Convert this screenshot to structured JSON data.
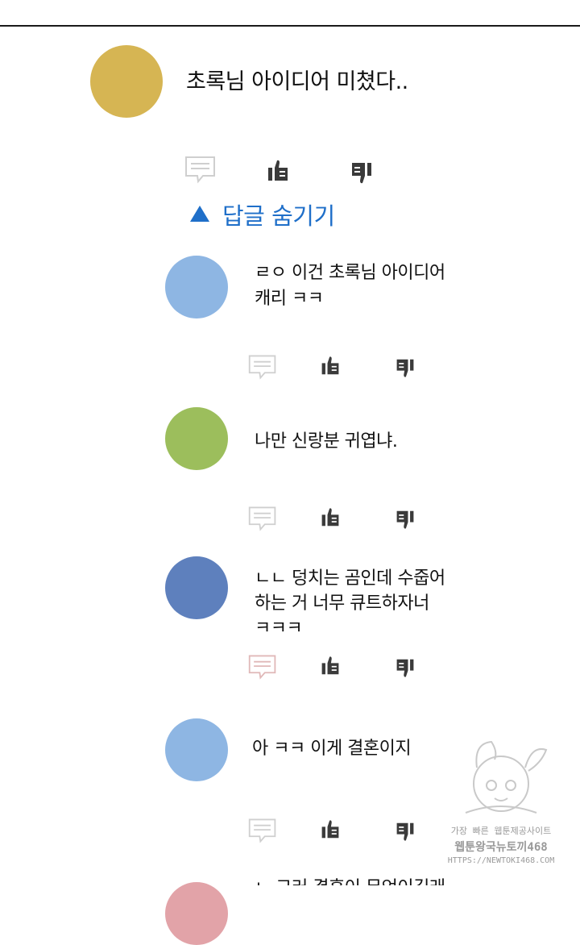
{
  "main_comment": {
    "avatar_color": "#d6b553",
    "text": "초록님 아이디어 미쳤다.."
  },
  "replies_toggle": {
    "icon": "triangle-up-icon",
    "label": "답글 숨기기",
    "color": "#1f6fc9"
  },
  "replies": [
    {
      "avatar_color": "#8eb6e3",
      "text": "ㄹㅇ 이건 초록님 아이디어\n캐리 ㅋㅋ"
    },
    {
      "avatar_color": "#9cbe5c",
      "text": "나만 신랑분 귀엽냐."
    },
    {
      "avatar_color": "#5e80bd",
      "text": "ㄴㄴ 덩치는 곰인데 수줍어\n하는 거 너무 큐트하자너\nㅋㅋㅋ"
    },
    {
      "avatar_color": "#8eb6e3",
      "text": "아 ㅋㅋ 이게 결혼이지"
    },
    {
      "avatar_color": "#e2a3a8",
      "text": "ㄴ 그러 결혼이 무엇이길래"
    }
  ],
  "action_icons": [
    "comment-icon",
    "thumbs-up-icon",
    "thumbs-down-icon"
  ],
  "watermark": {
    "line1": "가장 빠른 웹툰제공사이트",
    "line2": "웹툰왕국뉴토끼468",
    "line3": "HTTPS://NEWTOKI468.COM"
  }
}
